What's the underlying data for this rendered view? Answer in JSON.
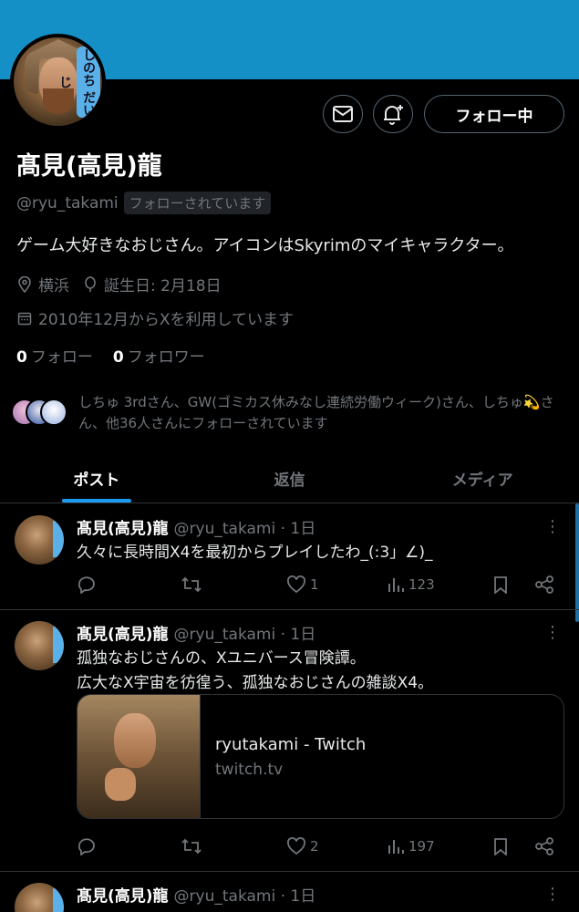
{
  "profile": {
    "name": "髙見(高見)龍",
    "handle": "@ryu_takami",
    "follows_you": "フォローされています",
    "bio": "ゲーム大好きなおじさん。アイコンはSkyrimのマイキャラクター。",
    "location": "横浜",
    "birthday": "誕生日: 2月18日",
    "joined": "2010年12月からXを利用しています",
    "following_count": "0",
    "following_label": "フォロー",
    "followers_count": "0",
    "followers_label": "フォロワー",
    "follow_button": "フォロー中",
    "avatar_sticker": "しのち だいじ",
    "known_followers": "しちゅ 3rdさん、GW(ゴミカス休みなし連続労働ウィーク)さん、しちゅ💫さん、他36人さんにフォローされています",
    "colors": {
      "banner": "#1590c6",
      "accent": "#1d9bf0"
    }
  },
  "tabs": [
    {
      "label": "ポスト",
      "active": true
    },
    {
      "label": "返信",
      "active": false
    },
    {
      "label": "メディア",
      "active": false
    }
  ],
  "posts": [
    {
      "name": "髙見(高見)龍",
      "meta": "@ryu_takami · 1日",
      "text": "久々に長時間X4を最初からプレイしたわ_(:3」∠)_",
      "likes": "1",
      "views": "123"
    },
    {
      "name": "髙見(高見)龍",
      "meta": "@ryu_takami · 1日",
      "text": "孤独なおじさんの、Xユニバース冒険譚。\n広大なX宇宙を彷徨う、孤独なおじさんの雑談X4。",
      "card_title": "ryutakami - Twitch",
      "card_domain": "twitch.tv",
      "likes": "2",
      "views": "197"
    },
    {
      "name": "髙見(高見)龍",
      "meta": "@ryu_takami · 1日"
    }
  ]
}
